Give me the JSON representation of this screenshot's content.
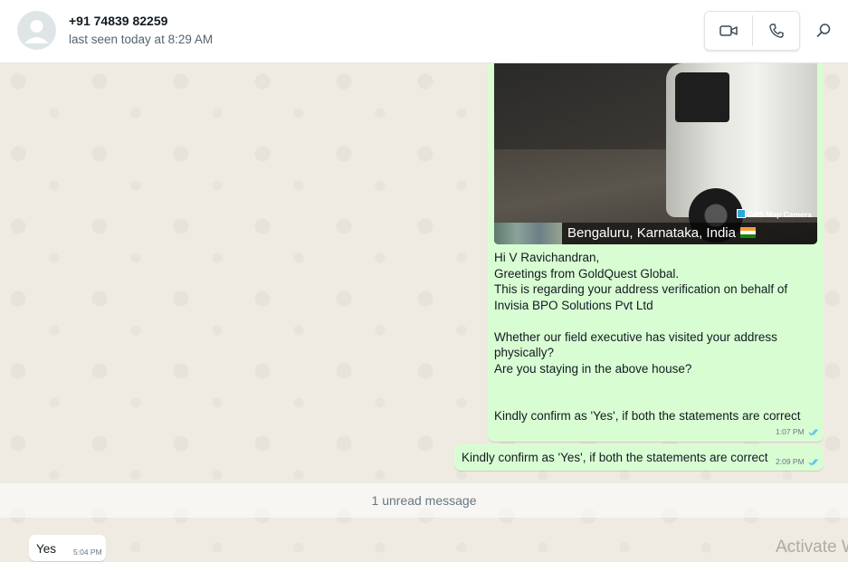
{
  "header": {
    "contact_name": "+91 74839 82259",
    "contact_status": "last seen today at 8:29 AM",
    "icons": [
      "avatar-placeholder-icon",
      "video-call-icon",
      "voice-call-icon",
      "search-icon"
    ]
  },
  "messages": {
    "photo_caption": {
      "gps_badge": "GPS Map Camera",
      "location": "Bengaluru, Karnataka, India"
    },
    "outgoing_1": {
      "lines": [
        "Hi V Ravichandran,",
        "Greetings from GoldQuest Global.",
        "This is regarding your address verification on behalf of",
        "Invisia BPO Solutions Pvt Ltd",
        "",
        "Whether our field executive has visited your address",
        "physically?",
        "Are you staying in the above house?",
        "",
        "",
        "Kindly confirm as 'Yes', if both the statements are correct"
      ],
      "time": "1:07 PM"
    },
    "outgoing_2": {
      "text": "Kindly confirm as 'Yes', if both the statements are correct",
      "time": "2:09 PM"
    },
    "unread_divider": "1 unread message",
    "incoming_1": {
      "text": "Yes",
      "time": "5:04 PM"
    }
  },
  "overlay": {
    "watermark": "Activate W"
  },
  "colors": {
    "outgoing_bubble": "#d9fdd3",
    "incoming_bubble": "#ffffff",
    "read_ticks": "#53bdeb",
    "wallpaper": "#efeae2"
  }
}
